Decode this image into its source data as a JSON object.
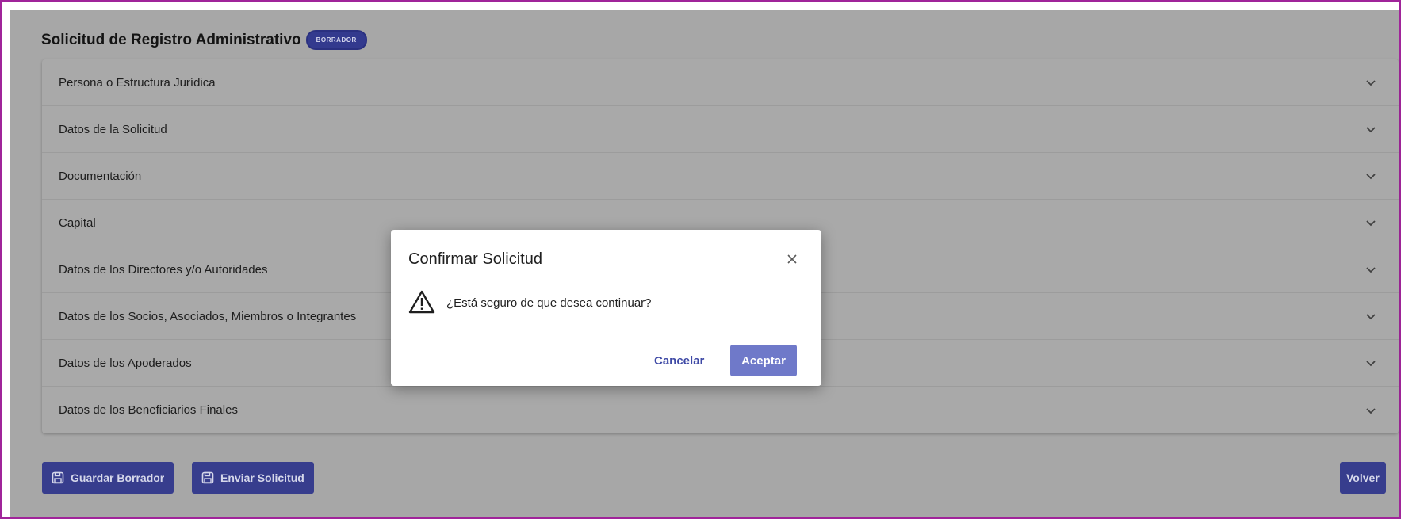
{
  "page": {
    "title": "Solicitud de Registro Administrativo",
    "status_badge": "BORRADOR"
  },
  "accordion": {
    "items": [
      {
        "label": "Persona o Estructura Jurídica"
      },
      {
        "label": "Datos de la Solicitud"
      },
      {
        "label": "Documentación"
      },
      {
        "label": "Capital"
      },
      {
        "label": "Datos de los Directores y/o Autoridades"
      },
      {
        "label": "Datos de los Socios, Asociados, Miembros o Integrantes"
      },
      {
        "label": "Datos de los Apoderados"
      },
      {
        "label": "Datos de los Beneficiarios Finales"
      }
    ]
  },
  "footer": {
    "save_draft_label": "Guardar Borrador",
    "send_label": "Enviar Solicitud",
    "back_label": "Volver"
  },
  "modal": {
    "title": "Confirmar Solicitud",
    "message": "¿Está seguro de que desea continuar?",
    "cancel_label": "Cancelar",
    "accept_label": "Aceptar"
  },
  "colors": {
    "primary": "#373d8d",
    "accept_button": "#6f79c9",
    "overlay_background": "#a7a7a7",
    "frame_border": "#a0249a"
  },
  "icons": {
    "chevron": "chevron-down-icon",
    "save": "floppy-disk-icon",
    "close": "close-icon",
    "warning": "warning-triangle-icon"
  }
}
